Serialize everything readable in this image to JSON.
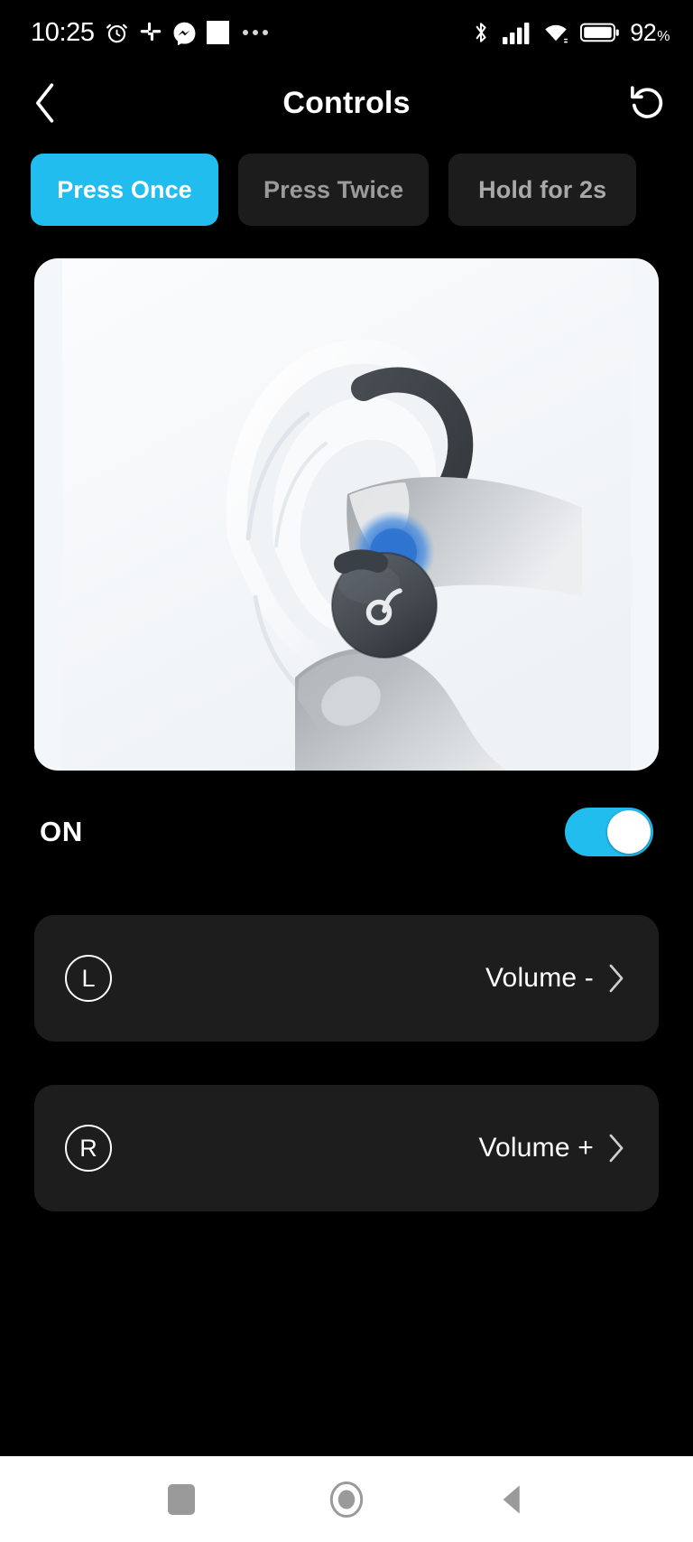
{
  "status_bar": {
    "time": "10:25",
    "battery_percent": "92",
    "percent_symbol": "%",
    "left_icons": [
      "alarm-clock-icon",
      "slack-icon",
      "messenger-icon",
      "white-square-icon",
      "overflow-ellipsis-icon"
    ],
    "right_icons": [
      "bluetooth-icon",
      "cellular-signal-icon",
      "wifi-icon",
      "battery-icon"
    ]
  },
  "app_bar": {
    "title": "Controls",
    "back_icon": "chevron-left-icon",
    "reset_icon": "reset-counterclockwise-icon"
  },
  "tabs": [
    {
      "label": "Press Once",
      "active": true
    },
    {
      "label": "Press Twice",
      "active": false
    },
    {
      "label": "Hold for 2s",
      "active": false
    }
  ],
  "illustration": {
    "alt": "Finger pressing earbud in ear",
    "card_background": "#f4f7f9",
    "earbud_color": "#4a4f55",
    "touch_dot_color": "#3a7fd5",
    "logo": "soundcore-logo-icon"
  },
  "toggle_row": {
    "label": "ON",
    "enabled": true,
    "accent_color": "#22bdef"
  },
  "control_rows": [
    {
      "side": "L",
      "side_icon": "left-earbud-badge-icon",
      "value": "Volume -",
      "chevron_icon": "chevron-right-icon"
    },
    {
      "side": "R",
      "side_icon": "right-earbud-badge-icon",
      "value": "Volume +",
      "chevron_icon": "chevron-right-icon"
    }
  ],
  "nav_bar": {
    "recents_icon": "square-recents-icon",
    "home_icon": "circle-home-icon",
    "back_icon": "triangle-back-icon",
    "icon_color": "#9a9a9a"
  },
  "theme": {
    "background": "#000000",
    "card_background": "#1d1d1d",
    "tab_inactive_background": "#1c1c1c",
    "tab_inactive_text": "#9b9b9b",
    "accent": "#22bdef",
    "text_primary": "#ffffff"
  }
}
